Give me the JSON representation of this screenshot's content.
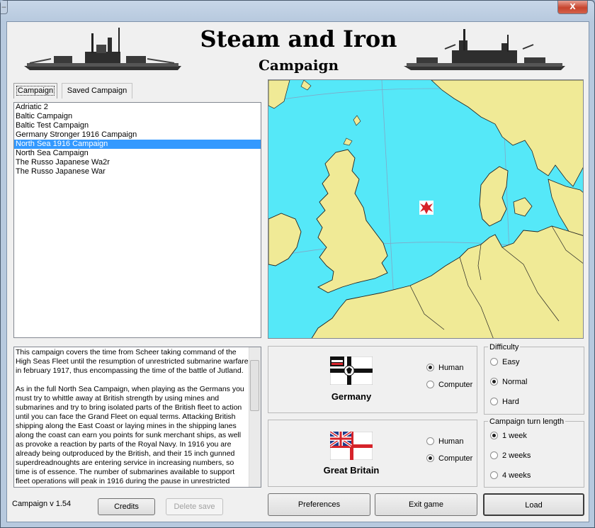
{
  "window": {
    "minimize_glyph": "‒",
    "close_glyph": "X"
  },
  "header": {
    "title": "Steam and Iron",
    "subtitle": "Campaign"
  },
  "tabs": [
    {
      "label": "Campaign",
      "active": true
    },
    {
      "label": "Saved Campaign",
      "active": false
    }
  ],
  "campaigns": [
    {
      "label": "Adriatic 2",
      "selected": false
    },
    {
      "label": "Baltic Campaign",
      "selected": false
    },
    {
      "label": "Baltic Test Campaign",
      "selected": false
    },
    {
      "label": "Germany Stronger 1916 Campaign",
      "selected": false
    },
    {
      "label": "North Sea 1916 Campaign",
      "selected": true
    },
    {
      "label": "North Sea Campaign",
      "selected": false
    },
    {
      "label": "The Russo Japanese Wa2r",
      "selected": false
    },
    {
      "label": "The Russo Japanese War",
      "selected": false
    }
  ],
  "description": {
    "paragraph1": "This campaign covers the time from Scheer taking command of the High Seas Fleet until the resumption of unrestricted submarine warfare in february 1917, thus encompassing the time of the battle of Jutland.",
    "paragraph2": "As in the full North Sea Campaign, when playing as the Germans you must try to whittle away at British strength by using mines and submarines and try to bring isolated parts of the British fleet to action until you can face the Grand Fleet on equal terms. Attacking British shipping along the East Coast or laying mines in the shipping lanes along the coast can earn you points for sunk merchant ships, as well as provoke a reaction by parts of the Royal Navy. In 1916 you are already being outproduced by the British, and their 15 inch gunned superdreadnoughts are entering service in increasing numbers, so time is of essence. The number of submarines available to support fleet operations will peak in 1916 during the pause in unrestricted"
  },
  "sides": [
    {
      "name": "Germany",
      "options": [
        {
          "label": "Human",
          "checked": true
        },
        {
          "label": "Computer",
          "checked": false
        }
      ]
    },
    {
      "name": "Great Britain",
      "options": [
        {
          "label": "Human",
          "checked": false
        },
        {
          "label": "Computer",
          "checked": true
        }
      ]
    }
  ],
  "difficulty": {
    "legend": "Difficulty",
    "options": [
      {
        "label": "Easy",
        "checked": false
      },
      {
        "label": "Normal",
        "checked": true
      },
      {
        "label": "Hard",
        "checked": false
      }
    ]
  },
  "turn_length": {
    "legend": "Campaign turn length",
    "options": [
      {
        "label": "1 week",
        "checked": true
      },
      {
        "label": "2 weeks",
        "checked": false
      },
      {
        "label": "4 weeks",
        "checked": false
      }
    ]
  },
  "footer": {
    "version": "Campaign v 1.54",
    "credits": "Credits",
    "delete_save": "Delete save",
    "preferences": "Preferences",
    "exit_game": "Exit game",
    "load": "Load"
  },
  "colors": {
    "sea": "#55e8f8",
    "land": "#f0ea96",
    "selection": "#3399ff",
    "marker": "#d6232a"
  },
  "icons": {
    "map_marker": "iron-cross-icon",
    "header_left": "battleship-silhouette-icon",
    "header_right": "battleship-silhouette-icon"
  }
}
